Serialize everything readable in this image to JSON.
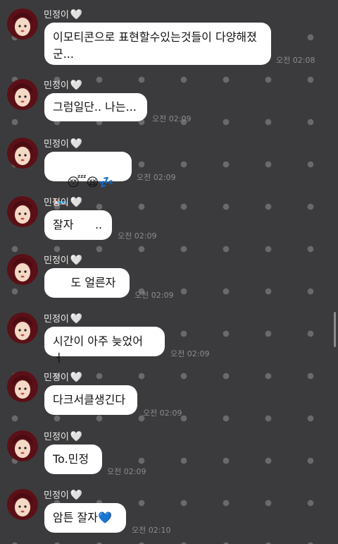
{
  "chat": {
    "messages": [
      {
        "sender": "민정이",
        "heart": "🤍",
        "text": "이모티콘으로 표현할수있는것들이 다양해졌\n군...",
        "time": "오전 02:08"
      },
      {
        "sender": "민정이",
        "heart": "🤍",
        "text": "그럼일단.. 나는...",
        "time": "오전 02:09"
      },
      {
        "sender": "민정이",
        "heart": "🤍",
        "emojis": [
          "😴",
          "😪",
          "💤",
          "🛏️"
        ],
        "time": "오전 02:09"
      },
      {
        "sender": "민정이",
        "heart": "🤍",
        "text": "잘자      ..",
        "time": "오전 02:09"
      },
      {
        "sender": "민정이",
        "heart": "🤍",
        "text": "     도 얼른자",
        "time": "오전 02:09"
      },
      {
        "sender": "민정이",
        "heart": "🤍",
        "text": "시간이 아주 늦었어 ㅓ",
        "time": "오전 02:09"
      },
      {
        "sender": "민정이",
        "heart": "🤍",
        "text": "다크서클생긴다",
        "time": "오전 02:09"
      },
      {
        "sender": "민정이",
        "heart": "🤍",
        "text": "To.민정",
        "time": "오전 02:09"
      },
      {
        "sender": "민정이",
        "heart": "🤍",
        "text": "암튼 잘자💙",
        "time": "오전 02:10"
      }
    ]
  },
  "colors": {
    "background": "#3b3b3d",
    "bubble": "#ffffff",
    "timestamp": "#8c8c8e",
    "sender": "#e9e9e9"
  },
  "icons": [
    "profile-avatar",
    "white-heart-icon",
    "scrollbar-thumb"
  ]
}
